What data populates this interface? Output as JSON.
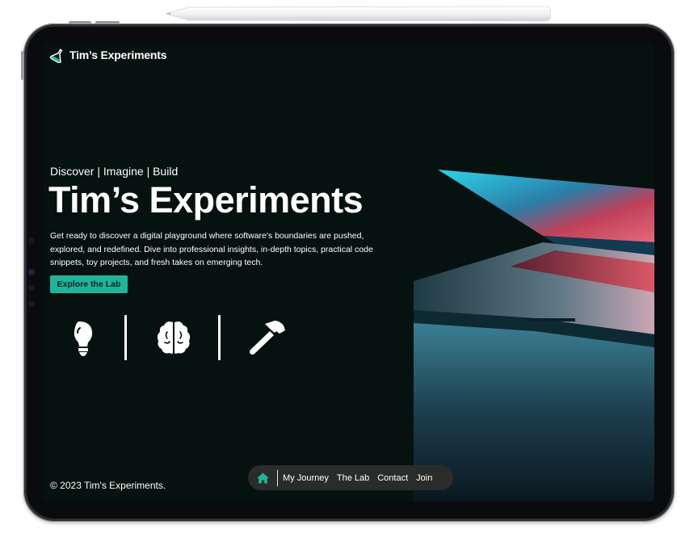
{
  "site": {
    "logo_text": "Tim’s Experiments",
    "accent_color": "#1fb59b",
    "background_color": "#061210"
  },
  "hero": {
    "tagline": "Discover | Imagine | Build",
    "title": "Tim’s Experiments",
    "description": "Get ready to discover a digital playground where software's boundaries are pushed, explored, and redefined. Dive into professional insights, in-depth topics, practical code snippets, toy projects, and fresh takes on emerging tech.",
    "cta_label": "Explore the Lab",
    "icons": [
      "lightbulb-icon",
      "brain-icon",
      "hammer-icon"
    ]
  },
  "footer": {
    "copyright": "© 2023 Tim's Experiments."
  },
  "nav": {
    "home_icon": "home-icon",
    "items": [
      "My Journey",
      "The Lab",
      "Contact",
      "Join"
    ]
  }
}
